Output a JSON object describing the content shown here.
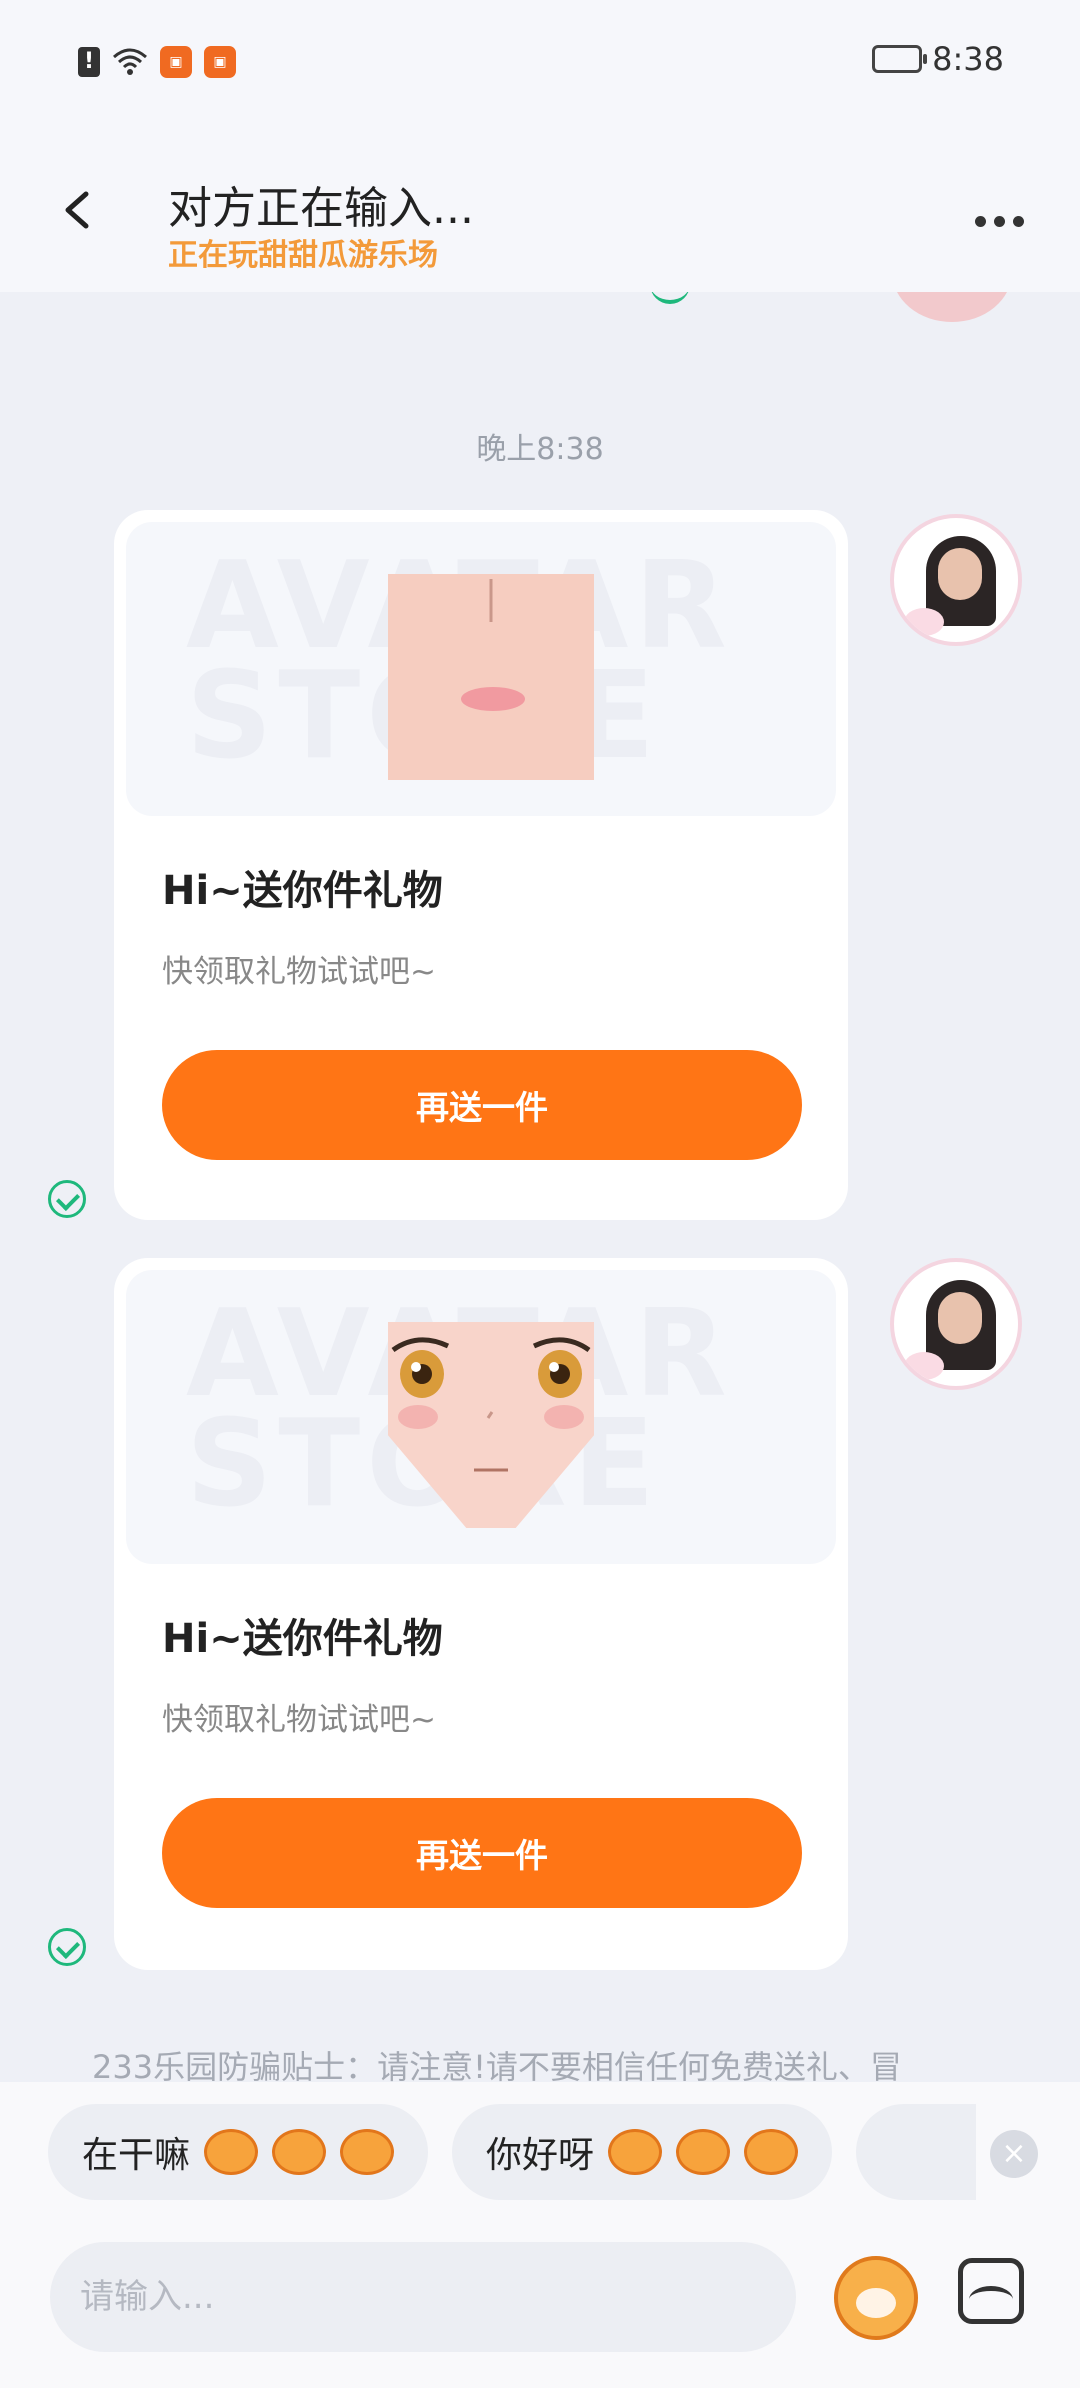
{
  "status_bar": {
    "time": "8:38",
    "alert": "!"
  },
  "header": {
    "title": "对方正在输入...",
    "subtitle": "正在玩甜甜瓜游乐场"
  },
  "chat": {
    "time_label": "晚上8:38",
    "cards": [
      {
        "title": "Hi~送你件礼物",
        "subtitle": "快领取礼物试试吧~",
        "button": "再送一件"
      },
      {
        "title": "Hi~送你件礼物",
        "subtitle": "快领取礼物试试吧~",
        "button": "再送一件"
      }
    ],
    "watermark": "AVATAR STORE",
    "tip": "233乐园防骗贴士：请注意!请不要相信任何免费送礼、冒"
  },
  "quick_replies": [
    "在干嘛",
    "你好呀"
  ],
  "input": {
    "placeholder": "请输入..."
  },
  "colors": {
    "accent": "#ff7515",
    "subtitle": "#f39a3a",
    "sent_check": "#1eb87c"
  }
}
